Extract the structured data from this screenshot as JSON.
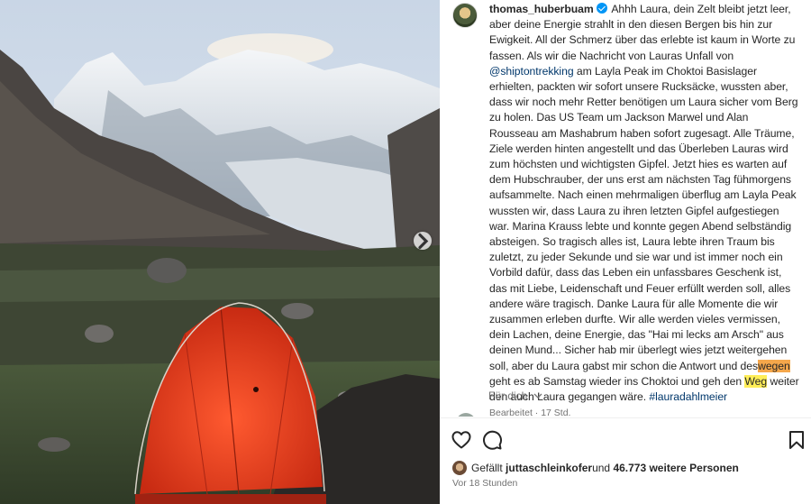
{
  "post": {
    "username": "thomas_huberbuam",
    "caption": {
      "p1": " Ahhh Laura, dein Zelt bleibt jetzt leer, aber deine Energie strahlt in den diesen Bergen bis hin zur Ewigkeit. All der Schmerz über das erlebte ist kaum in Worte zu fassen. Als wir die Nachricht von Lauras Unfall von ",
      "mention": "@shiptontrekking",
      "p2": " am Layla Peak im Choktoi Basislager erhielten, packten wir sofort unsere Rucksäcke, wussten aber, dass wir noch mehr Retter benötigen um Laura sicher vom Berg zu holen. Das US Team um Jackson Marwel und Alan Rousseau am Mashabrum haben sofort zugesagt. Alle Träume, Ziele werden hinten angestellt und das Überleben Lauras wird zum höchsten und wichtigsten Gipfel. Jetzt hies es warten auf dem Hubschrauber, der uns erst am nächsten Tag fühmorgens aufsammelte. Nach einen mehrmaligen überflug am Layla Peak wussten wir, dass Laura zu ihren letzten Gipfel aufgestiegen war. Marina Krauss lebte und konnte gegen Abend selbständig absteigen. So tragisch alles ist, Laura lebte ihren Traum bis zuletzt, zu jeder Sekunde und sie war und ist immer noch ein Vorbild dafür, dass das Leben ein unfassbares Geschenk ist, das mit Liebe, Leidenschaft und Feuer erfüllt werden soll, alles andere wäre tragisch. Danke Laura für alle Momente die wir zusammen erleben durfte. Wir alle werden vieles vermissen, dein Lachen, deine Energie, das \"Hai mi lecks am Arsch\" aus deinen Mund... Sicher hab mir überlegt wies jetzt weitergehen soll, aber du Laura gabst mir schon die Antwort und des",
      "hl1": "wegen",
      "p3": " geht es ab Samstag wieder ins Choktoi und geh den ",
      "hl2": "Weg",
      "p4": " weiter den auch Laura gegangen wäre. ",
      "hashtag": "#lauradahlmeier"
    },
    "edited": "Bearbeitet · 17 Std.",
    "translate": "Für dich"
  },
  "likes": {
    "prefix": "Gefällt ",
    "user": "juttaschleinkofer",
    "middle": " und ",
    "count": "46.773 weitere Personen"
  },
  "time_ago": "Vor 18 Stunden",
  "icons": {
    "like": "heart-icon",
    "comment": "comment-icon",
    "save": "bookmark-icon",
    "next": "chevron-right-icon",
    "verified": "verified-badge-icon"
  },
  "colors": {
    "tent": "#e53a1f",
    "link": "#00376b",
    "verified": "#0095f6",
    "highlight_orange": "#f5a74b",
    "highlight_yellow": "#ffee58"
  }
}
